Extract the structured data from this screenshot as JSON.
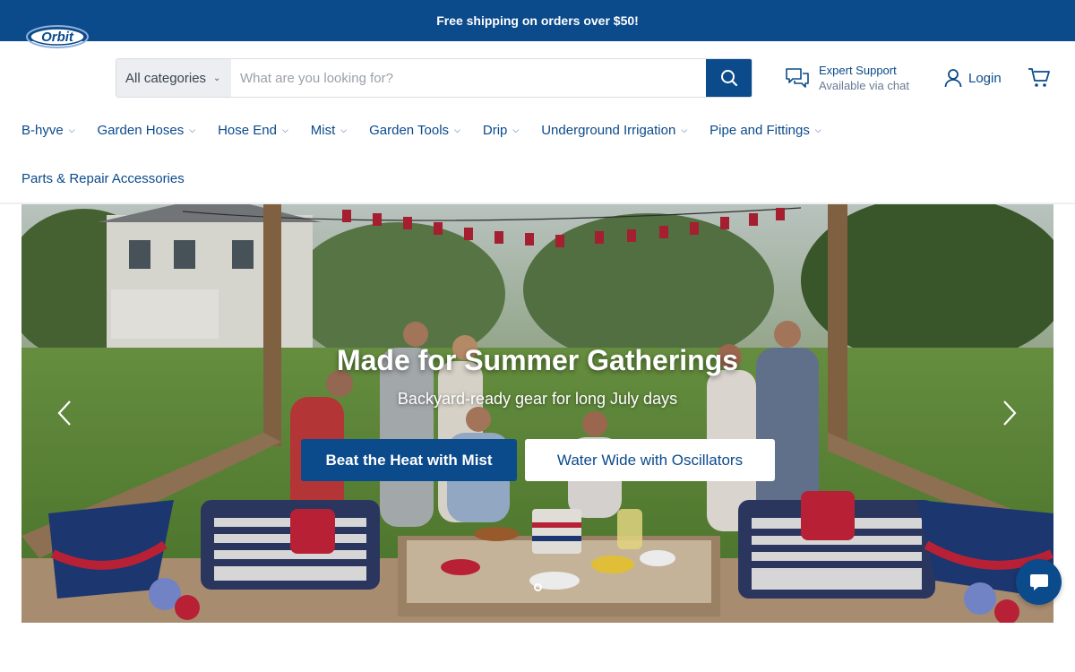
{
  "announcement": {
    "text": "Free shipping on orders over $50!"
  },
  "header": {
    "logo_text": "Orbit",
    "search": {
      "category": "All categories",
      "placeholder": "What are you looking for?"
    },
    "support": {
      "title": "Expert Support",
      "subtitle": "Available via chat"
    },
    "login_label": "Login"
  },
  "nav": {
    "items": [
      {
        "label": "B-hyve"
      },
      {
        "label": "Garden Hoses"
      },
      {
        "label": "Hose End"
      },
      {
        "label": "Mist"
      },
      {
        "label": "Garden Tools"
      },
      {
        "label": "Drip"
      },
      {
        "label": "Underground Irrigation"
      },
      {
        "label": "Pipe and Fittings"
      }
    ],
    "second_row": [
      {
        "label": "Parts & Repair Accessories"
      }
    ]
  },
  "hero": {
    "title": "Made for Summer Gatherings",
    "subtitle": "Backyard-ready gear for long July days",
    "primary_cta": "Beat the Heat with Mist",
    "secondary_cta": "Water Wide with Oscillators"
  },
  "colors": {
    "brand": "#0b4a8b",
    "announcement_bg": "#0b4a8b",
    "nav_text": "#0b4a8b"
  },
  "icons": {
    "search": "search-icon",
    "support": "chat-bubbles-icon",
    "login": "user-icon",
    "cart": "cart-icon",
    "chat": "chat-icon"
  }
}
